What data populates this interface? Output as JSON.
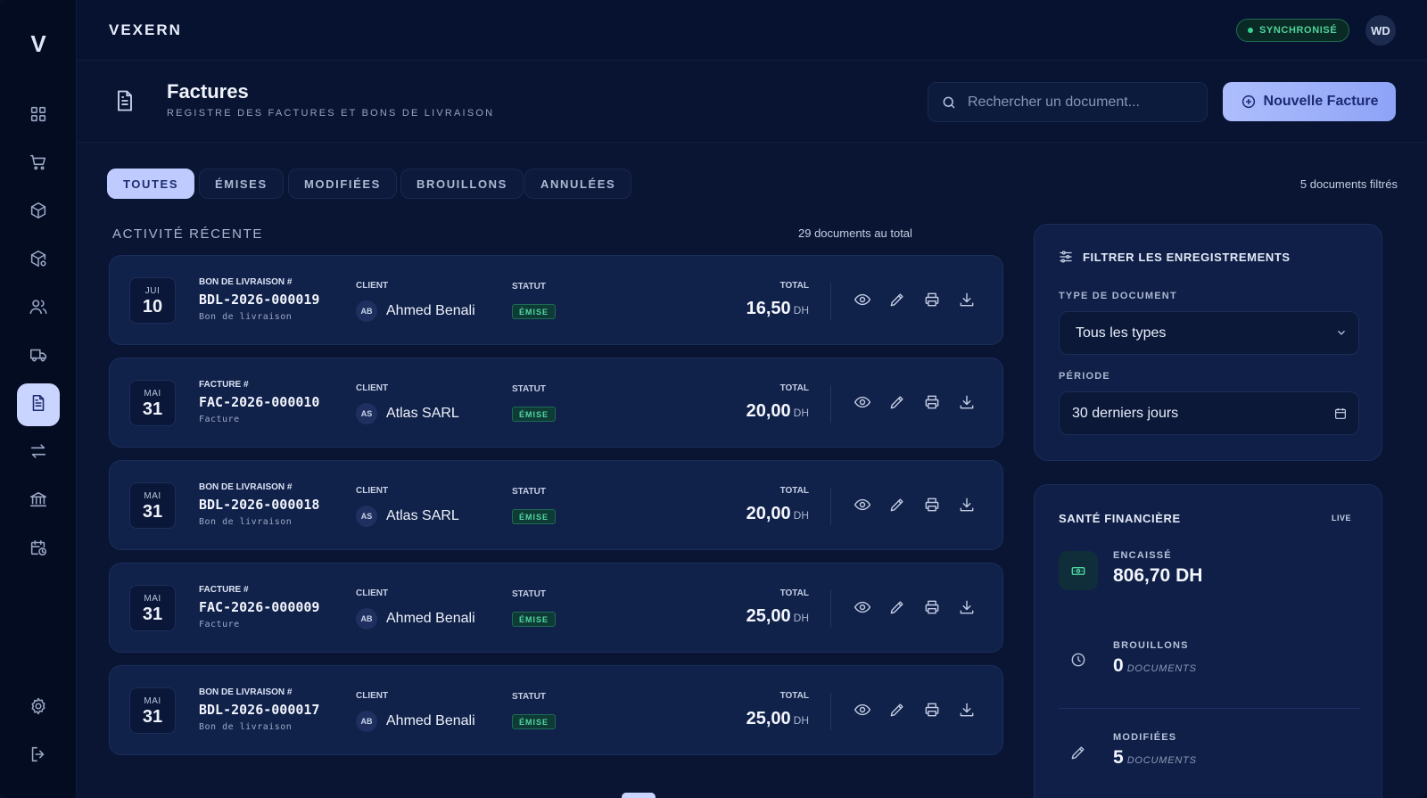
{
  "sidebar": {
    "logo": "V",
    "items": [
      {
        "icon": "dashboard-icon",
        "active": false
      },
      {
        "icon": "cart-icon",
        "active": false
      },
      {
        "icon": "box-icon",
        "active": false
      },
      {
        "icon": "box-settings-icon",
        "active": false
      },
      {
        "icon": "users-icon",
        "active": false
      },
      {
        "icon": "truck-icon",
        "active": false
      },
      {
        "icon": "document-icon",
        "active": true
      },
      {
        "icon": "transfer-icon",
        "active": false
      },
      {
        "icon": "bank-icon",
        "active": false
      },
      {
        "icon": "calendar-clock-icon",
        "active": false
      }
    ],
    "bottom": [
      {
        "icon": "gear-icon"
      },
      {
        "icon": "logout-icon"
      }
    ]
  },
  "topbar": {
    "brand": "VEXERN",
    "sync_label": "SYNCHRONISÉ",
    "user_initials": "WD"
  },
  "header": {
    "title": "Factures",
    "subtitle": "REGISTRE DES FACTURES ET BONS DE LIVRAISON",
    "search_placeholder": "Rechercher un document...",
    "new_button": "Nouvelle Facture"
  },
  "tabs": [
    {
      "label": "TOUTES",
      "active": true
    },
    {
      "label": "ÉMISES",
      "active": false
    },
    {
      "label": "MODIFIÉES",
      "active": false
    },
    {
      "label": "BROUILLONS",
      "active": false
    },
    {
      "label": "ANNULÉES",
      "active": false
    }
  ],
  "filtered_count": "5 documents filtrés",
  "activity": {
    "title": "ACTIVITÉ RÉCENTE",
    "total": "29 documents au total",
    "labels": {
      "client": "CLIENT",
      "status": "STATUT",
      "total": "TOTAL",
      "currency": "DH"
    },
    "rows": [
      {
        "month": "JUI",
        "day": "10",
        "type": "BON DE LIVRAISON #",
        "number": "BDL-2026-000019",
        "kind": "Bon de livraison",
        "client_initials": "AB",
        "client": "Ahmed Benali",
        "status": "ÉMISE",
        "amount": "16,50"
      },
      {
        "month": "MAI",
        "day": "31",
        "type": "FACTURE #",
        "number": "FAC-2026-000010",
        "kind": "Facture",
        "client_initials": "AS",
        "client": "Atlas SARL",
        "status": "ÉMISE",
        "amount": "20,00"
      },
      {
        "month": "MAI",
        "day": "31",
        "type": "BON DE LIVRAISON #",
        "number": "BDL-2026-000018",
        "kind": "Bon de livraison",
        "client_initials": "AS",
        "client": "Atlas SARL",
        "status": "ÉMISE",
        "amount": "20,00"
      },
      {
        "month": "MAI",
        "day": "31",
        "type": "FACTURE #",
        "number": "FAC-2026-000009",
        "kind": "Facture",
        "client_initials": "AB",
        "client": "Ahmed Benali",
        "status": "ÉMISE",
        "amount": "25,00"
      },
      {
        "month": "MAI",
        "day": "31",
        "type": "BON DE LIVRAISON #",
        "number": "BDL-2026-000017",
        "kind": "Bon de livraison",
        "client_initials": "AB",
        "client": "Ahmed Benali",
        "status": "ÉMISE",
        "amount": "25,00"
      }
    ]
  },
  "filter_panel": {
    "title": "FILTRER LES ENREGISTREMENTS",
    "type_label": "TYPE DE DOCUMENT",
    "type_value": "Tous les types",
    "period_label": "PÉRIODE",
    "period_value": "30 derniers jours"
  },
  "health_panel": {
    "title": "SANTÉ FINANCIÈRE",
    "live": "LIVE",
    "stats": [
      {
        "label": "ENCAISSÉ",
        "value": "806,70 DH",
        "unit": ""
      },
      {
        "label": "BROUILLONS",
        "value": "0",
        "unit": "DOCUMENTS"
      },
      {
        "label": "MODIFIÉES",
        "value": "5",
        "unit": "DOCUMENTS"
      }
    ]
  },
  "colors": {
    "accent": "#bfcbff",
    "success": "#4fd7a2",
    "background": "#0a1533"
  }
}
